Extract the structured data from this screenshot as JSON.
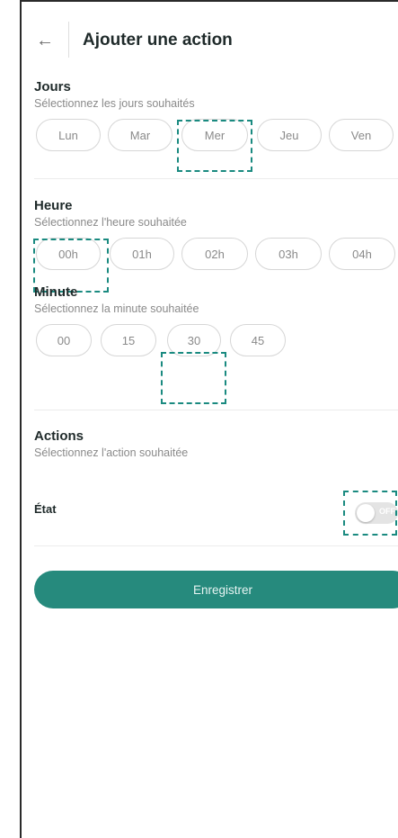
{
  "header": {
    "back_icon": "arrow-left-icon",
    "title": "Ajouter une action"
  },
  "jours": {
    "title": "Jours",
    "subtitle": "Sélectionnez les jours souhaités",
    "options": [
      "Lun",
      "Mar",
      "Mer",
      "Jeu",
      "Ven"
    ],
    "selected": "Mer"
  },
  "heure": {
    "title": "Heure",
    "subtitle": "Sélectionnez l'heure souhaitée",
    "options": [
      "00h",
      "01h",
      "02h",
      "03h",
      "04h"
    ],
    "selected": "00h"
  },
  "minute": {
    "title": "Minute",
    "subtitle": "Sélectionnez la minute souhaitée",
    "options": [
      "00",
      "15",
      "30",
      "45"
    ],
    "selected": "30"
  },
  "actions": {
    "title": "Actions",
    "subtitle": "Sélectionnez l'action souhaitée",
    "etat_label": "État",
    "toggle_text": "OFF",
    "toggle_on": false
  },
  "save_label": "Enregistrer",
  "colors": {
    "accent": "#268a7d",
    "selection_outline": "#1a8a80"
  }
}
